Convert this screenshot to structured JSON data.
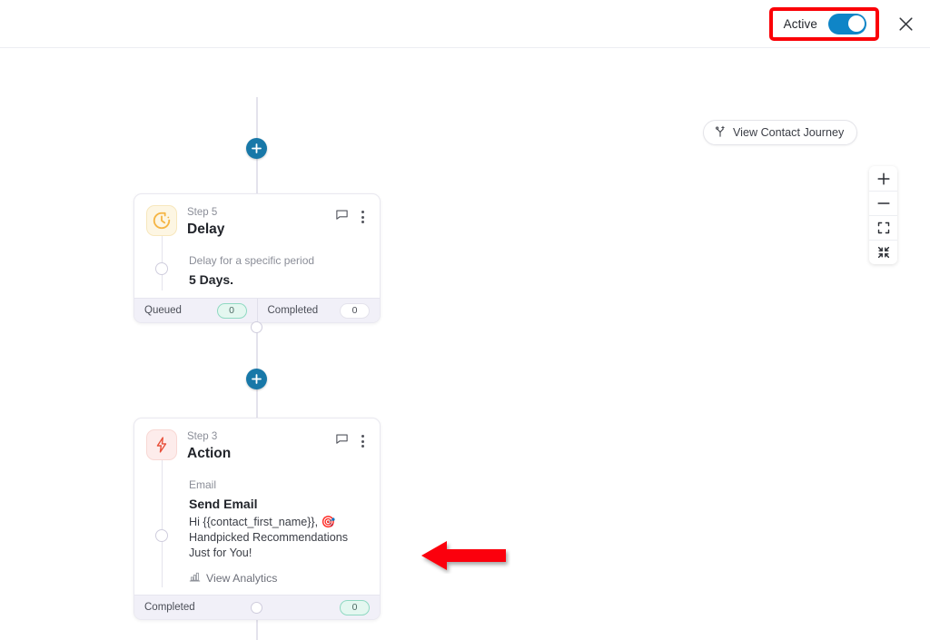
{
  "header": {
    "status_toggle": {
      "label": "Active",
      "state": "on",
      "accent_color": "#0f85c7",
      "highlight_color": "#fb0007"
    },
    "close_icon": "close-icon"
  },
  "canvas": {
    "journey_button": {
      "label": "View Contact Journey",
      "icon": "journey-branch-icon"
    },
    "zoom_controls": [
      {
        "name": "zoom-in",
        "glyph": "+"
      },
      {
        "name": "zoom-out",
        "glyph": "−"
      },
      {
        "name": "fit-view",
        "glyph": "fit-screen-icon"
      },
      {
        "name": "collapse-view",
        "glyph": "collapse-icon"
      }
    ],
    "add_buttons": [
      {
        "name": "add-step-above-delay",
        "label": "+"
      },
      {
        "name": "add-step-between",
        "label": "+"
      }
    ],
    "steps": [
      {
        "id": "delay",
        "step_number": "Step 5",
        "title": "Delay",
        "icon": "clock-icon",
        "icon_color": "#f5b544",
        "icon_bg": "#fdf6e3",
        "detail_label": "Delay for a specific period",
        "detail_value": "5 Days.",
        "stats": [
          {
            "label": "Queued",
            "value": "0",
            "style": "teal"
          },
          {
            "label": "Completed",
            "value": "0",
            "style": "plain"
          }
        ]
      },
      {
        "id": "action",
        "step_number": "Step 3",
        "title": "Action",
        "icon": "lightning-bolt-icon",
        "icon_color": "#e8503a",
        "icon_bg": "#fdeceb",
        "detail_label": "Email",
        "detail_value": "Send Email",
        "detail_sub": "Hi {{contact_first_name}}, 🎯 Handpicked Recommendations Just for You!",
        "analytics_link": "View Analytics",
        "analytics_icon": "bar-chart-icon",
        "stats": [
          {
            "label": "Completed",
            "value": "0",
            "style": "teal"
          }
        ]
      }
    ]
  },
  "annotation": {
    "arrow": {
      "name": "red-pointer-arrow",
      "direction": "left",
      "color": "#fb0007"
    }
  }
}
